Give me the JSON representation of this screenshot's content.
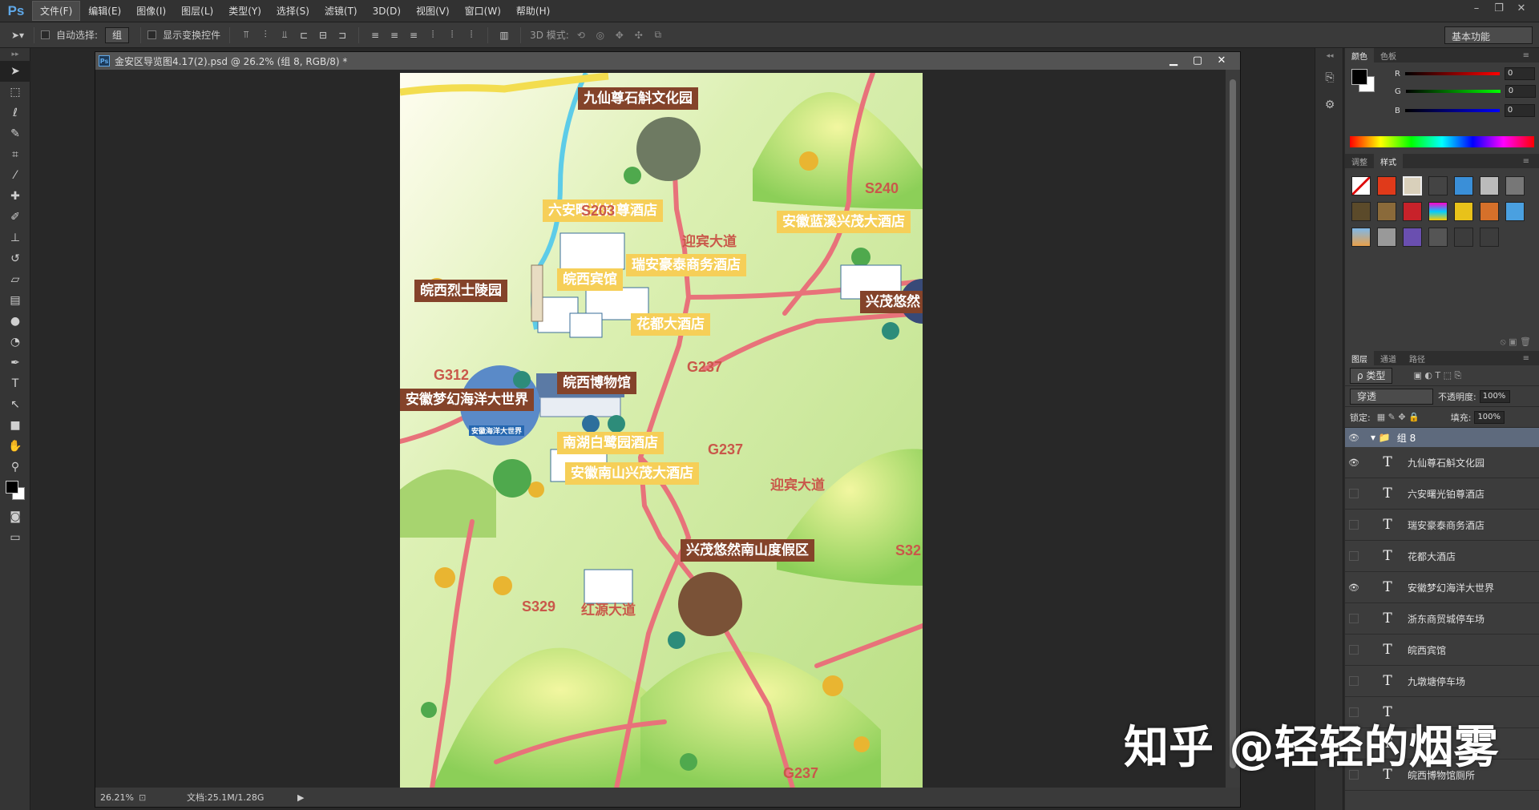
{
  "app": {
    "logo": "Ps"
  },
  "menu": [
    "文件(F)",
    "编辑(E)",
    "图像(I)",
    "图层(L)",
    "类型(Y)",
    "选择(S)",
    "滤镜(T)",
    "3D(D)",
    "视图(V)",
    "窗口(W)",
    "帮助(H)"
  ],
  "options_bar": {
    "auto_select_label": "自动选择:",
    "auto_select_value": "组",
    "show_transform_label": "显示变换控件",
    "mode_3d_label": "3D 模式:",
    "workspace": "基本功能"
  },
  "document": {
    "title": "金安区导览图4.17(2).psd @ 26.2% (组 8, RGB/8) *",
    "zoom": "26.21%",
    "doc_size": "文档:25.1M/1.28G"
  },
  "map": {
    "labels": {
      "jiuxian": "九仙尊石斛文化园",
      "liuan_hotel": "六安曙光铂尊酒店",
      "lanxi": "安徽蓝溪兴茂大酒店",
      "ruian": "瑞安豪泰商务酒店",
      "wanxi_guest": "皖西宾馆",
      "lieshi": "皖西烈士陵园",
      "huadu": "花都大酒店",
      "museum": "皖西博物馆",
      "ocean": "安徽梦幻海洋大世界",
      "nanhu": "南湖白鹭园酒店",
      "nanshan_hotel": "安徽南山兴茂大酒店",
      "xingmao_resort": "兴茂悠然南山度假区",
      "xingmao_right": "兴茂悠然"
    },
    "roads": {
      "s203": "S203",
      "s240": "S240",
      "yingbin1": "迎宾大道",
      "yingbin2": "迎宾大道",
      "g237a": "G237",
      "g237b": "G237",
      "g237c": "G237",
      "g312": "G312",
      "s329": "S329",
      "hongyuan": "红源大道",
      "s32": "S32"
    },
    "ocean_sign": "安徽海洋大世界"
  },
  "panels": {
    "color_tabs": [
      "颜色",
      "色板"
    ],
    "rgb": [
      {
        "ch": "R",
        "v": "0"
      },
      {
        "ch": "G",
        "v": "0"
      },
      {
        "ch": "B",
        "v": "0"
      }
    ],
    "adjust_tabs": [
      "调整",
      "样式"
    ],
    "layer_tabs": [
      "图层",
      "通道",
      "路径"
    ],
    "kind_filter": "ρ 类型",
    "blend_mode": "穿透",
    "opacity_label": "不透明度:",
    "opacity": "100%",
    "lock_label": "锁定:",
    "fill_label": "填充:",
    "fill": "100%",
    "group_name": "组 8",
    "layers": [
      {
        "name": "九仙尊石斛文化园",
        "visible": true
      },
      {
        "name": "六安曙光铂尊酒店",
        "visible": false
      },
      {
        "name": "瑞安豪泰商务酒店",
        "visible": false
      },
      {
        "name": "花都大酒店",
        "visible": false
      },
      {
        "name": "安徽梦幻海洋大世界",
        "visible": true
      },
      {
        "name": "浙东商贸城停车场",
        "visible": false
      },
      {
        "name": "皖西宾馆",
        "visible": false
      },
      {
        "name": "九墩塘停车场",
        "visible": false
      },
      {
        "name": "",
        "visible": false
      },
      {
        "name": "",
        "visible": false
      },
      {
        "name": "皖西博物馆厕所",
        "visible": false
      }
    ]
  },
  "watermark": "知乎 @轻轻的烟雾",
  "colors": {
    "brown_label": "#84432a",
    "yellow_label": "#f6cf58",
    "road": "#e8727a",
    "fg": "#000000",
    "bg": "#ffffff"
  }
}
